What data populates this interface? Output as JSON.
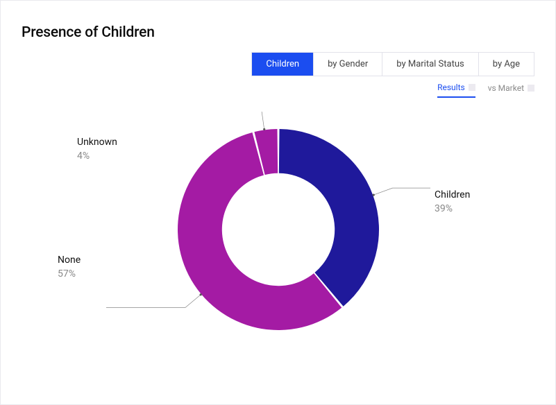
{
  "title": "Presence of Children",
  "tabs": [
    {
      "label": "Children",
      "active": true
    },
    {
      "label": "by Gender",
      "active": false
    },
    {
      "label": "by Marital Status",
      "active": false
    },
    {
      "label": "by Age",
      "active": false
    }
  ],
  "subtabs": [
    {
      "label": "Results",
      "active": true
    },
    {
      "label": "vs Market",
      "active": false
    }
  ],
  "chart_data": {
    "type": "pie",
    "title": "Presence of Children",
    "series": [
      {
        "name": "Children",
        "value": 39,
        "color": "#1f199b",
        "label": "39%"
      },
      {
        "name": "None",
        "value": 57,
        "color": "#a41ba4",
        "label": "57%"
      },
      {
        "name": "Unknown",
        "value": 4,
        "color": "#a41ba4",
        "label": "4%"
      }
    ],
    "inner_radius_ratio": 0.56
  }
}
